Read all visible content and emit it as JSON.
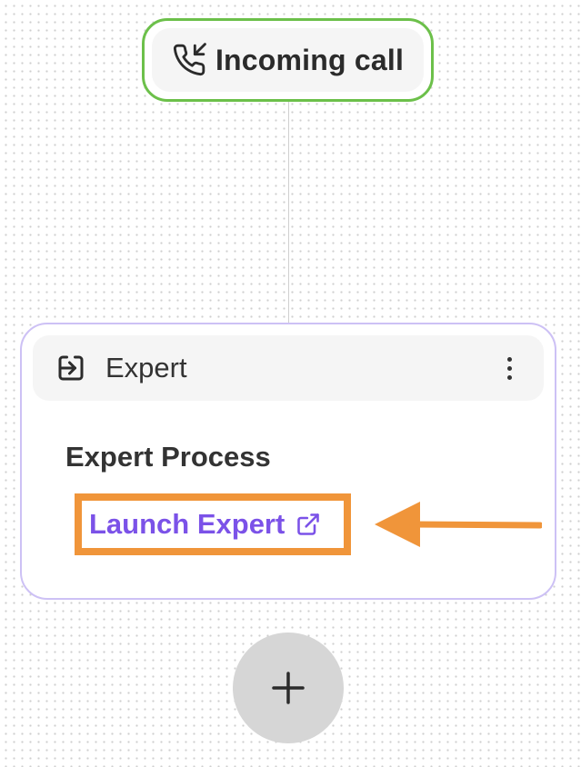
{
  "trigger": {
    "title": "Incoming call",
    "icon": "phone-incoming-icon",
    "border_color": "#6cc04a"
  },
  "step": {
    "title": "Expert",
    "icon": "enter-icon",
    "menu_icon": "more-vertical-icon",
    "border_color": "#cdc1f5",
    "section_title": "Expert Process",
    "link_label": "Launch Expert",
    "link_icon": "external-link-icon",
    "link_color": "#7b52e8"
  },
  "annotation": {
    "highlight_color": "#f0953a",
    "arrow_icon": "arrow-left-icon"
  },
  "add_step": {
    "icon": "plus-icon"
  }
}
